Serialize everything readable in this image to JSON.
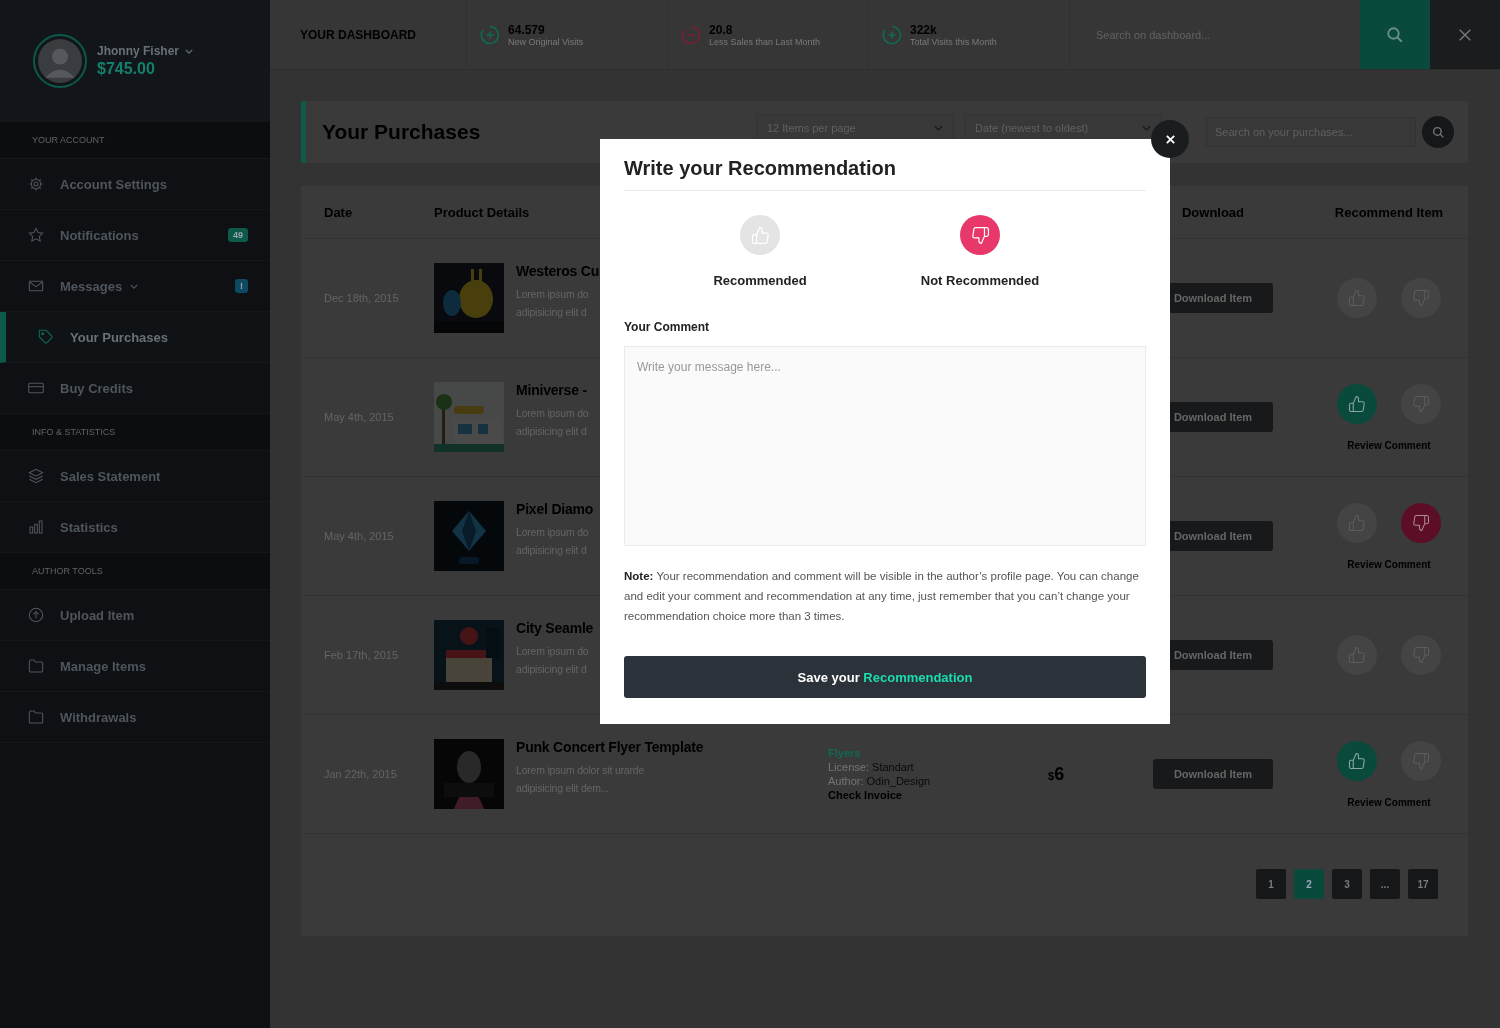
{
  "sidebar": {
    "user": {
      "name": "Jhonny Fisher",
      "balance": "$745.00"
    },
    "sections": [
      {
        "title": "YOUR ACCOUNT",
        "items": [
          {
            "label": "Account Settings",
            "selected": false
          },
          {
            "label": "Notifications",
            "selected": false,
            "badge": {
              "text": "49",
              "color": "#0c5a4a"
            }
          },
          {
            "label": "Messages",
            "selected": false,
            "expandable": true,
            "badge": {
              "text": "!",
              "color": "#0d4a62"
            }
          },
          {
            "label": "Your Purchases",
            "selected": true
          },
          {
            "label": "Buy Credits",
            "selected": false
          }
        ]
      },
      {
        "title": "INFO & STATISTICS",
        "items": [
          {
            "label": "Sales Statement",
            "selected": false
          },
          {
            "label": "Statistics",
            "selected": false
          }
        ]
      },
      {
        "title": "AUTHOR TOOLS",
        "items": [
          {
            "label": "Upload Item",
            "selected": false
          },
          {
            "label": "Manage Items",
            "selected": false
          },
          {
            "label": "Withdrawals",
            "selected": false
          }
        ]
      }
    ]
  },
  "topbar": {
    "title": "YOUR DASHBOARD",
    "stats": [
      {
        "value": "64.579",
        "label": "New Original Visits",
        "kind": "up"
      },
      {
        "value": "20.8",
        "label": "Less Sales than Last Month",
        "kind": "down"
      },
      {
        "value": "322k",
        "label": "Total Visits this Month",
        "kind": "up"
      }
    ],
    "search": {
      "placeholder": "Search on dashboard..."
    }
  },
  "purchases": {
    "title": "Your Purchases",
    "filters": [
      "12 Items per page",
      "Date (newest to oldest)"
    ],
    "search": {
      "placeholder": "Search on your purchases..."
    },
    "columns": [
      "Date",
      "Product Details",
      "Download",
      "Recommend Item"
    ],
    "rows": [
      {
        "date": "Dec 18th, 2015",
        "title": "Westeros Cu",
        "desc": [
          "Lorem ipsum do",
          "adipisicing elit d"
        ],
        "download": "Download Item",
        "liked": false,
        "disliked": false
      },
      {
        "date": "May 4th, 2015",
        "title": "Miniverse -",
        "desc": [
          "Lorem ipsum do",
          "adipisicing elit d"
        ],
        "download": "Download Item",
        "liked": true,
        "disliked": false,
        "review": "Review Comment"
      },
      {
        "date": "May 4th, 2015",
        "title": "Pixel Diamo",
        "desc": [
          "Lorem ipsum do",
          "adipisicing elit d"
        ],
        "download": "Download Item",
        "liked": false,
        "disliked": true,
        "review": "Review Comment"
      },
      {
        "date": "Feb 17th, 2015",
        "title": "City Seamle",
        "desc": [
          "Lorem ipsum do",
          "adipisicing elit d"
        ],
        "download": "Download Item",
        "liked": false,
        "disliked": false
      },
      {
        "date": "Jan 22th, 2015",
        "title": "Punk Concert Flyer Template",
        "desc": [
          "Lorem ipsum dolor sit urarde",
          "adipisicing elit dem..."
        ],
        "details": {
          "category": "Flyers",
          "license_label": "License:",
          "license": "Standart",
          "author_label": "Author:",
          "author": "Odin_Design",
          "invoice": "Check Invoice"
        },
        "currency": "$",
        "price": "6",
        "download": "Download Item",
        "liked": true,
        "disliked": false,
        "review": "Review Comment"
      }
    ],
    "pages": [
      {
        "label": "1",
        "selected": false
      },
      {
        "label": "2",
        "selected": true
      },
      {
        "label": "3",
        "selected": false
      },
      {
        "label": "...",
        "selected": false
      },
      {
        "label": "17",
        "selected": false
      }
    ]
  },
  "modal": {
    "title": "Write your Recommendation",
    "options": [
      {
        "label": "Recommended",
        "kind": "up",
        "selected": false
      },
      {
        "label": "Not Recommended",
        "kind": "down",
        "selected": true
      }
    ],
    "comment_label": "Your Comment",
    "placeholder": "Write your message here...",
    "note": "**Note:** Your recommendation and comment will be visible in the author’s profile page. You can change and edit your comment and recommendation at any time, just remember that you can’t change your recommendation choice more than 3 times.",
    "button": {
      "text": "Save your",
      "highlight": "Recommendation"
    }
  }
}
